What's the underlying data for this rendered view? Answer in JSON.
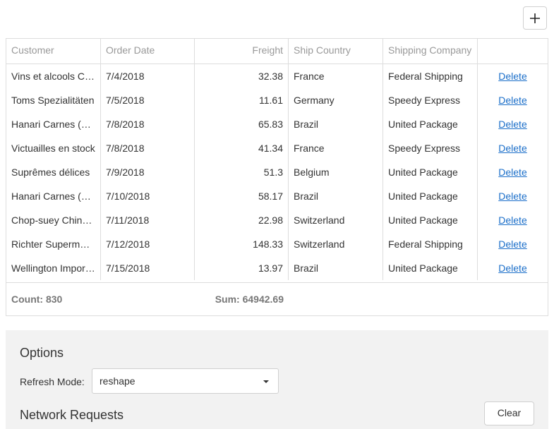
{
  "toolbar": {
    "add_icon": "plus-icon"
  },
  "grid": {
    "columns": [
      "Customer",
      "Order Date",
      "Freight",
      "Ship Country",
      "Shipping Company",
      ""
    ],
    "rows": [
      {
        "customer": "Vins et alcools Chevalier",
        "date": "7/4/2018",
        "freight": "32.38",
        "country": "France",
        "company": "Federal Shipping",
        "action": "Delete"
      },
      {
        "customer": "Toms Spezialitäten",
        "date": "7/5/2018",
        "freight": "11.61",
        "country": "Germany",
        "company": "Speedy Express",
        "action": "Delete"
      },
      {
        "customer": "Hanari Carnes (Brazil)",
        "date": "7/8/2018",
        "freight": "65.83",
        "country": "Brazil",
        "company": "United Package",
        "action": "Delete"
      },
      {
        "customer": "Victuailles en stock",
        "date": "7/8/2018",
        "freight": "41.34",
        "country": "France",
        "company": "Speedy Express",
        "action": "Delete"
      },
      {
        "customer": "Suprêmes délices",
        "date": "7/9/2018",
        "freight": "51.3",
        "country": "Belgium",
        "company": "United Package",
        "action": "Delete"
      },
      {
        "customer": "Hanari Carnes (Brazil)",
        "date": "7/10/2018",
        "freight": "58.17",
        "country": "Brazil",
        "company": "United Package",
        "action": "Delete"
      },
      {
        "customer": "Chop-suey Chinese",
        "date": "7/11/2018",
        "freight": "22.98",
        "country": "Switzerland",
        "company": "United Package",
        "action": "Delete"
      },
      {
        "customer": "Richter Supermarkt",
        "date": "7/12/2018",
        "freight": "148.33",
        "country": "Switzerland",
        "company": "Federal Shipping",
        "action": "Delete"
      },
      {
        "customer": "Wellington Importadora",
        "date": "7/15/2018",
        "freight": "13.97",
        "country": "Brazil",
        "company": "United Package",
        "action": "Delete"
      }
    ],
    "footer": {
      "count": "Count: 830",
      "sum": "Sum: 64942.69"
    }
  },
  "options": {
    "title": "Options",
    "refresh_label": "Refresh Mode:",
    "refresh_value": "reshape",
    "network_title": "Network Requests",
    "clear_label": "Clear"
  }
}
